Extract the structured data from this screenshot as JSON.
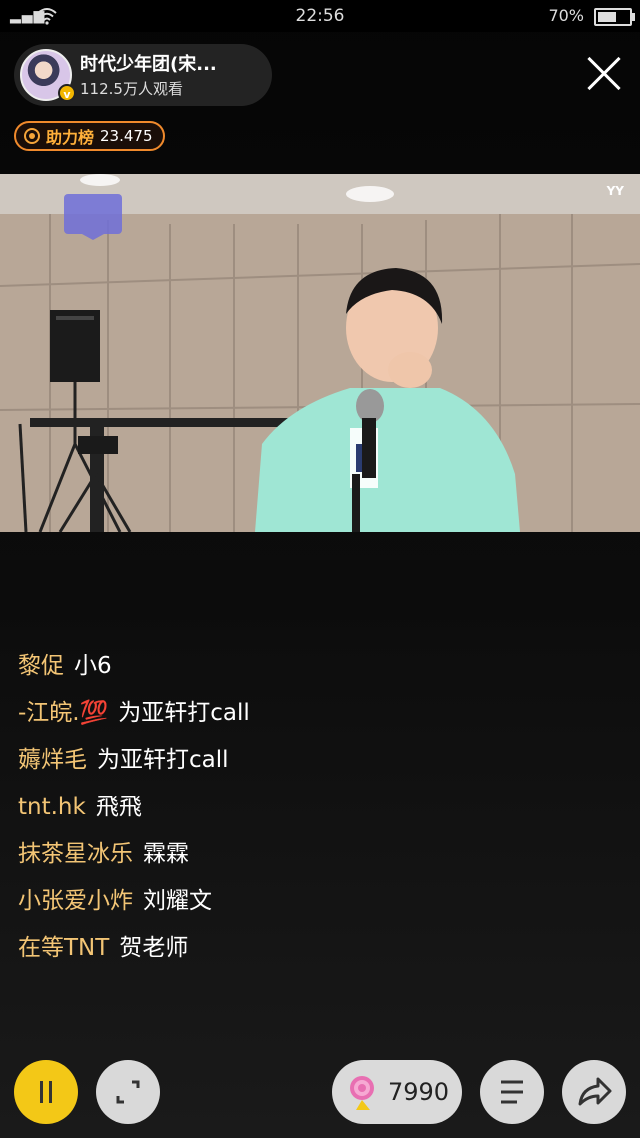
{
  "status_bar": {
    "time": "22:56",
    "battery": "70%",
    "battery_level": 0.7,
    "signal_icon": "signal-icon",
    "wifi_icon": "wifi-icon"
  },
  "host": {
    "name": "时代少年团(宋...",
    "viewers": "112.5万人观看",
    "badge": "v"
  },
  "rank": {
    "label": "助力榜",
    "value": "23.475",
    "icon": "shield-icon"
  },
  "video": {
    "watermark": "YY"
  },
  "comments": [
    {
      "user": "黎促",
      "text": "小6"
    },
    {
      "user": "-江皖.💯",
      "text": "为亚轩打call"
    },
    {
      "user": "薅烊毛",
      "text": "为亚轩打call"
    },
    {
      "user": "tnt.hk",
      "text": "飛飛"
    },
    {
      "user": "抹茶星冰乐",
      "text": "霖霖"
    },
    {
      "user": "小张爱小炸",
      "text": "刘耀文"
    },
    {
      "user": "在等TNT",
      "text": "贺老师"
    }
  ],
  "controls": {
    "gift_count": "7990",
    "icons": [
      "pause-icon",
      "fullscreen-icon",
      "lollipop-icon",
      "menu-icon",
      "share-icon",
      "close-icon"
    ]
  },
  "colors": {
    "username": "#f3c575",
    "accent": "#f3c817",
    "rank_border": "#f08a2c"
  }
}
